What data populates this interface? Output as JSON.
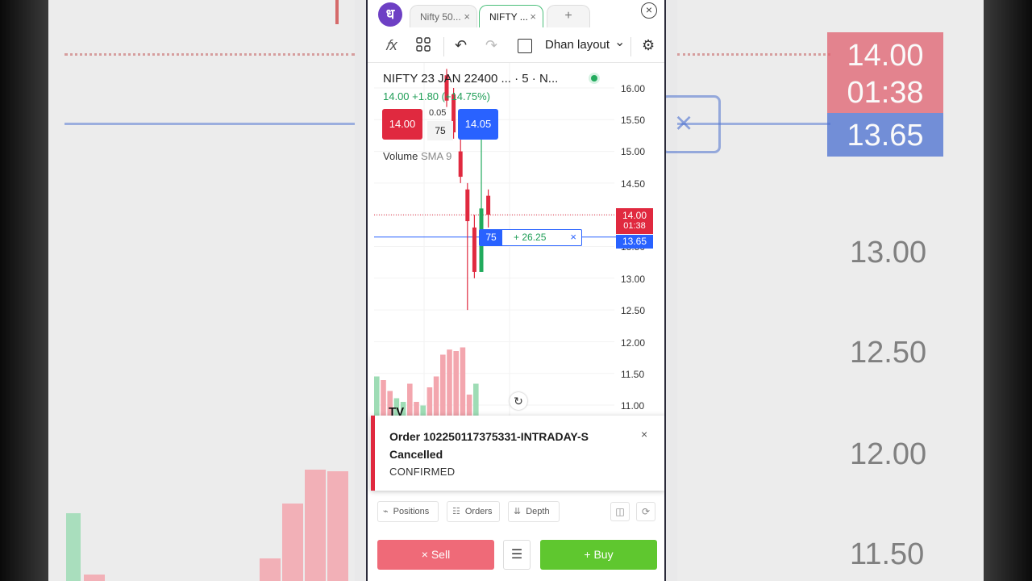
{
  "tabs": [
    {
      "label": "Nifty 50...",
      "close": "×"
    },
    {
      "label": "NIFTY ...",
      "close": "×"
    }
  ],
  "tab_add": "+",
  "window_close": "×",
  "brand_letter": "ध",
  "toolbar": {
    "fx": "𝑓x",
    "undo": "↶",
    "redo": "↷",
    "layout_label": "Dhan layout",
    "layout_chevron": "⌄",
    "settings": "⚙"
  },
  "chart": {
    "symbol": "NIFTY 23 JAN 22400 ...  · 5 · N...",
    "change": "14.00  +1.80 (+14.75%)",
    "sell_price": "14.00",
    "buy_price": "14.05",
    "spread": "0.05",
    "quantity": "75",
    "volume_label": "Volume",
    "volume_indicator": "SMA 9",
    "y_labels": [
      "16.00",
      "15.50",
      "15.00",
      "14.50",
      "14.00",
      "13.50",
      "13.00",
      "12.50",
      "12.00",
      "11.50",
      "11.00"
    ],
    "price_tag_line1": "14.00",
    "price_tag_line2": "01:38",
    "position_tag": "13.65",
    "position_qty": "75",
    "position_pnl": "+ 26.25",
    "position_close": "×",
    "reset": "↻",
    "tv": "TV",
    "colors": {
      "up": "#22ab5d",
      "down": "#e0293f",
      "vol_down": "#f3a6ae",
      "vol_up": "#9edcb5"
    }
  },
  "chart_data": {
    "type": "candlestick",
    "ylim": [
      11.0,
      16.0
    ],
    "candles": [
      {
        "o": 16.2,
        "h": 16.3,
        "l": 15.7,
        "c": 15.8,
        "dir": "down"
      },
      {
        "o": 15.9,
        "h": 16.0,
        "l": 15.2,
        "c": 15.3,
        "dir": "down"
      },
      {
        "o": 15.0,
        "h": 15.3,
        "l": 14.5,
        "c": 14.6,
        "dir": "down"
      },
      {
        "o": 14.4,
        "h": 14.5,
        "l": 12.5,
        "c": 13.9,
        "dir": "down"
      },
      {
        "o": 13.8,
        "h": 14.0,
        "l": 13.0,
        "c": 13.1,
        "dir": "down"
      },
      {
        "o": 13.1,
        "h": 15.2,
        "l": 13.1,
        "c": 14.1,
        "dir": "up"
      },
      {
        "o": 14.3,
        "h": 14.4,
        "l": 13.8,
        "c": 14.0,
        "dir": "down"
      }
    ],
    "volume": [
      {
        "v": 0.55,
        "dir": "up"
      },
      {
        "v": 0.5,
        "dir": "down"
      },
      {
        "v": 0.35,
        "dir": "down"
      },
      {
        "v": 0.25,
        "dir": "up"
      },
      {
        "v": 0.2,
        "dir": "up"
      },
      {
        "v": 0.45,
        "dir": "down"
      },
      {
        "v": 0.2,
        "dir": "down"
      },
      {
        "v": 0.15,
        "dir": "up"
      },
      {
        "v": 0.4,
        "dir": "down"
      },
      {
        "v": 0.55,
        "dir": "down"
      },
      {
        "v": 0.85,
        "dir": "down"
      },
      {
        "v": 0.92,
        "dir": "down"
      },
      {
        "v": 0.9,
        "dir": "down"
      },
      {
        "v": 0.95,
        "dir": "down"
      },
      {
        "v": 0.3,
        "dir": "down"
      },
      {
        "v": 0.45,
        "dir": "up"
      }
    ],
    "last_price": 14.0,
    "position_price": 13.65
  },
  "toast": {
    "title": "Order 102250117375331-INTRADAY-S Cancelled",
    "message": "CONFIRMED",
    "close": "×"
  },
  "panels": {
    "positions": "Positions",
    "orders": "Orders",
    "depth": "Depth"
  },
  "actions": {
    "sell": "×  Sell",
    "buy": "+  Buy",
    "mid_icon": "☰"
  },
  "background": {
    "tag_red_1": "14.00",
    "tag_red_2": "01:38",
    "tag_blue": "13.65",
    "y_labels": [
      "13.00",
      "12.50",
      "12.00",
      "11.50"
    ],
    "x_mark": "×"
  }
}
